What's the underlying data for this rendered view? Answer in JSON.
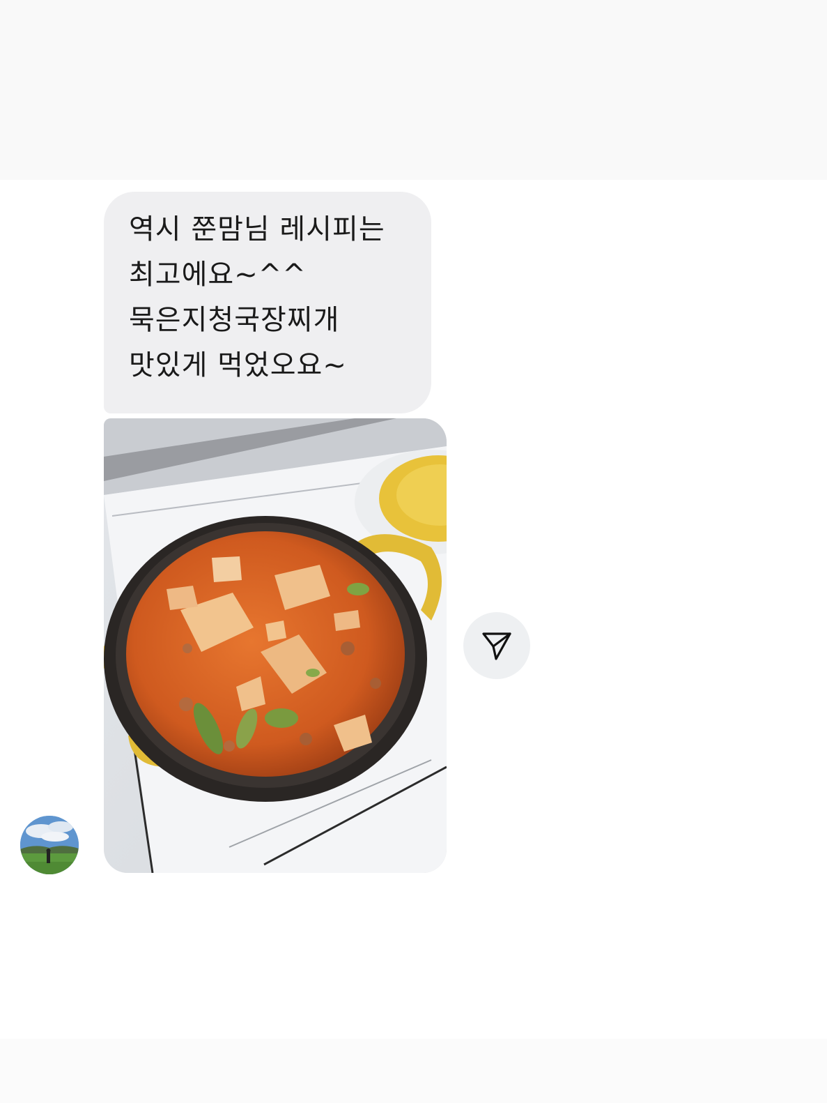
{
  "message": {
    "lines": [
      "역시 쭌맘님 레시피는",
      "최고에요~^^",
      "묵은지청국장찌개",
      "맛있게 먹었오요~"
    ]
  },
  "photo": {
    "subject": "stew-pot-photo"
  },
  "share_button": {
    "icon": "send-icon"
  },
  "avatar": {
    "icon": "profile-avatar"
  }
}
